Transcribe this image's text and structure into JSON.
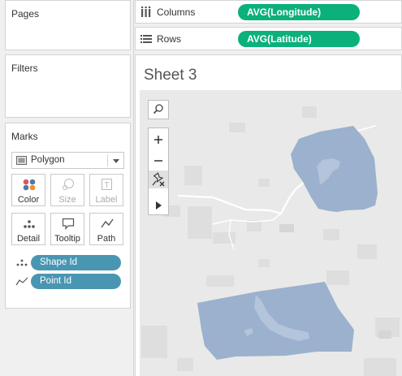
{
  "pages": {
    "title": "Pages"
  },
  "filters": {
    "title": "Filters"
  },
  "marks": {
    "title": "Marks",
    "mark_type": "Polygon",
    "buttons": {
      "color": "Color",
      "size": "Size",
      "label": "Label",
      "detail": "Detail",
      "tooltip": "Tooltip",
      "path": "Path"
    },
    "fields": [
      {
        "name": "Shape Id",
        "encoding": "detail"
      },
      {
        "name": "Point Id",
        "encoding": "path"
      }
    ]
  },
  "shelves": {
    "columns": {
      "label": "Columns",
      "field": "AVG(Longitude)"
    },
    "rows": {
      "label": "Rows",
      "field": "AVG(Latitude)"
    }
  },
  "sheet": {
    "title": "Sheet 3"
  },
  "map": {
    "background_color": "#e9e9e9",
    "polygon_color": "#8fa8c8",
    "controls": [
      "search-icon",
      "zoom-in-icon",
      "zoom-out-icon",
      "pin-icon",
      "expand-arrow-icon"
    ]
  },
  "colors": {
    "pill_green": "#0bb07b",
    "pill_blue": "#4996b2"
  }
}
